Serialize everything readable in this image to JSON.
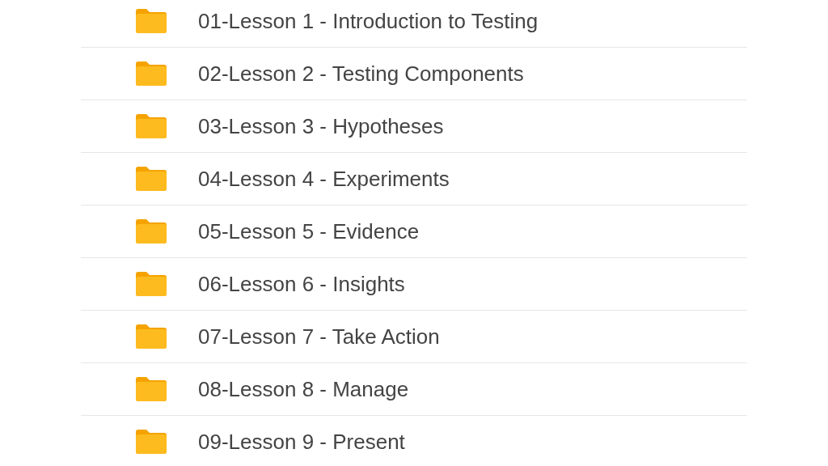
{
  "folders": [
    {
      "name": "01-Lesson 1 - Introduction to Testing"
    },
    {
      "name": "02-Lesson 2 - Testing Components"
    },
    {
      "name": "03-Lesson 3 - Hypotheses"
    },
    {
      "name": "04-Lesson 4 - Experiments"
    },
    {
      "name": "05-Lesson 5 - Evidence"
    },
    {
      "name": "06-Lesson 6 - Insights"
    },
    {
      "name": "07-Lesson 7 - Take Action"
    },
    {
      "name": "08-Lesson 8 - Manage"
    },
    {
      "name": "09-Lesson 9 - Present"
    }
  ]
}
